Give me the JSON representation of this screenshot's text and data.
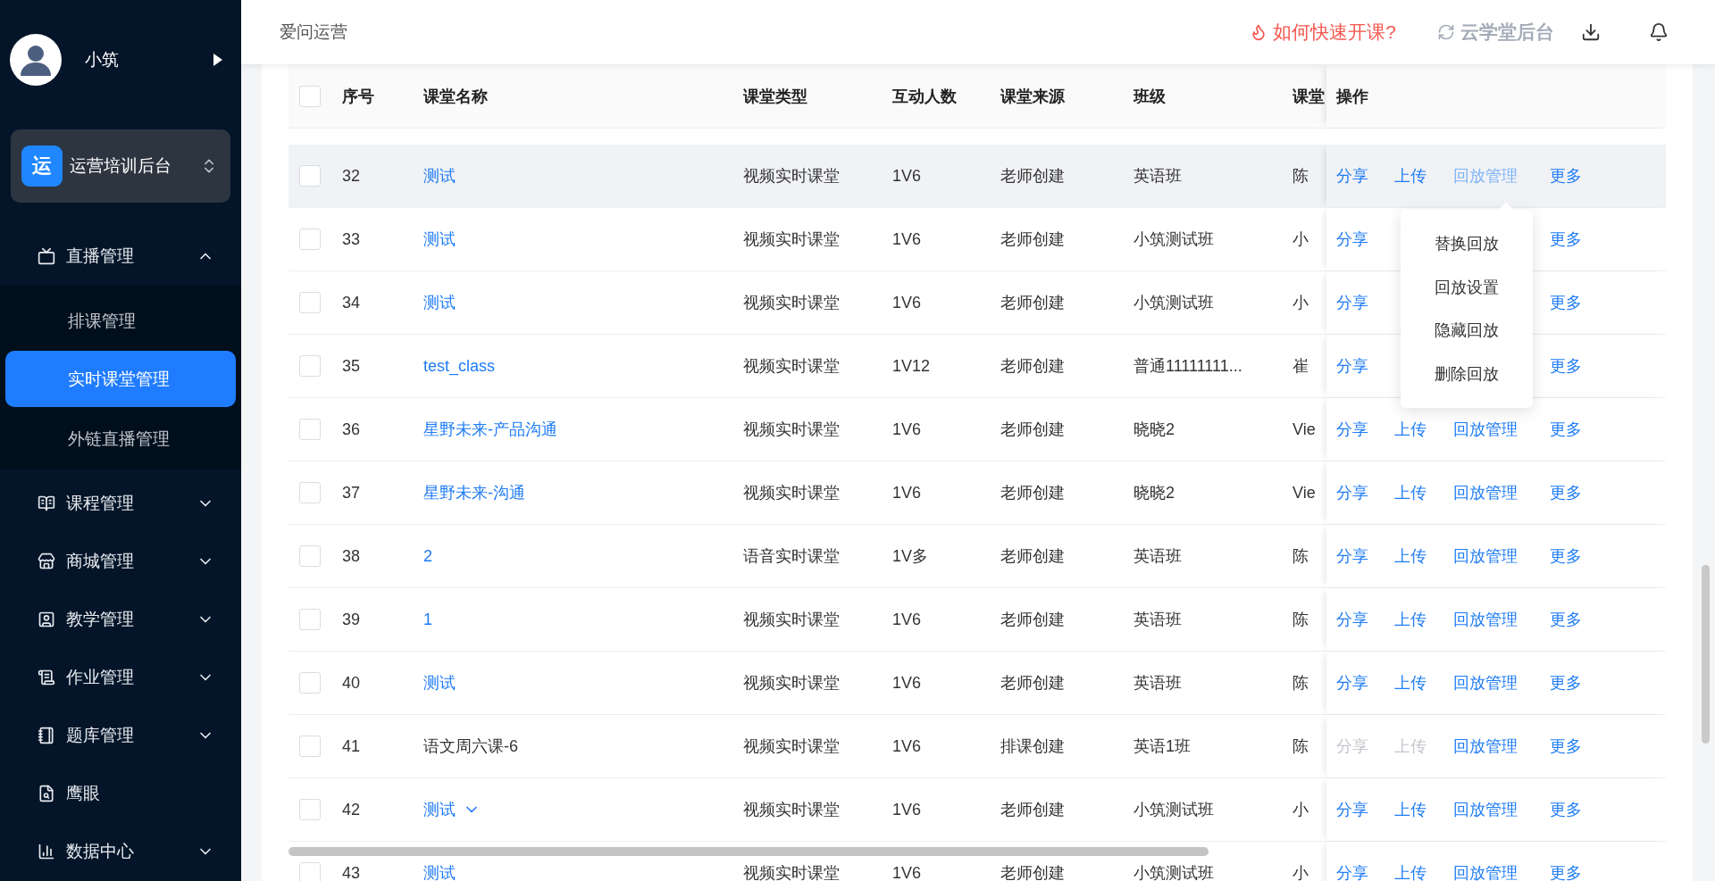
{
  "sidebar": {
    "user": {
      "name": "小筑"
    },
    "org": {
      "badge": "运",
      "name": "运营培训后台"
    },
    "menu": [
      {
        "label": "直播管理",
        "kind": "group",
        "expanded": true,
        "selected": false,
        "children": [
          {
            "label": "排课管理",
            "selected": false
          },
          {
            "label": "实时课堂管理",
            "selected": true
          },
          {
            "label": "外链直播管理",
            "selected": false
          }
        ]
      },
      {
        "label": "课程管理",
        "kind": "group",
        "expanded": false,
        "selected": false
      },
      {
        "label": "商城管理",
        "kind": "group",
        "expanded": false,
        "selected": false
      },
      {
        "label": "教学管理",
        "kind": "group",
        "expanded": false,
        "selected": false
      },
      {
        "label": "作业管理",
        "kind": "group",
        "expanded": false,
        "selected": false
      },
      {
        "label": "题库管理",
        "kind": "group",
        "expanded": false,
        "selected": false
      },
      {
        "label": "鹰眼",
        "kind": "page",
        "selected": false
      },
      {
        "label": "数据中心",
        "kind": "group",
        "expanded": false,
        "selected": false
      }
    ]
  },
  "header": {
    "title": "爱问运营",
    "help_link": "如何快速开课?",
    "switch_link": "云学堂后台"
  },
  "table": {
    "header_checked": false,
    "columns": [
      "序号",
      "课堂名称",
      "课堂类型",
      "互动人数",
      "课堂来源",
      "班级",
      "课堂",
      "操作"
    ],
    "rows": [
      {
        "checked": false,
        "hovered": true,
        "no": "32",
        "name": "测试",
        "name_link": true,
        "expandable": false,
        "type": "视频实时课堂",
        "members": "1V6",
        "source": "老师创建",
        "class": "英语班",
        "column_7": "陈",
        "actions": [
          {
            "kind": "share",
            "label": "分享",
            "disabled": false,
            "active": false
          },
          {
            "kind": "upload",
            "label": "上传",
            "disabled": false,
            "active": false
          },
          {
            "kind": "replay",
            "label": "回放管理",
            "disabled": false,
            "active": true
          },
          {
            "kind": "more",
            "label": "更多",
            "disabled": false,
            "active": false
          }
        ],
        "menu": {
          "items": [
            "替换回放",
            "回放设置",
            "隐藏回放",
            "删除回放"
          ]
        }
      },
      {
        "checked": false,
        "hovered": false,
        "no": "33",
        "name": "测试",
        "name_link": true,
        "expandable": false,
        "type": "视频实时课堂",
        "members": "1V6",
        "source": "老师创建",
        "class": "小筑测试班",
        "column_7": "小",
        "actions": [
          {
            "kind": "share",
            "label": "分享",
            "disabled": false,
            "active": false
          },
          {
            "kind": "more",
            "label": "更多",
            "disabled": false,
            "active": false
          }
        ]
      },
      {
        "checked": false,
        "hovered": false,
        "no": "34",
        "name": "测试",
        "name_link": true,
        "expandable": false,
        "type": "视频实时课堂",
        "members": "1V6",
        "source": "老师创建",
        "class": "小筑测试班",
        "column_7": "小",
        "actions": [
          {
            "kind": "share",
            "label": "分享",
            "disabled": false,
            "active": false
          },
          {
            "kind": "more",
            "label": "更多",
            "disabled": false,
            "active": false
          }
        ]
      },
      {
        "checked": false,
        "hovered": false,
        "no": "35",
        "name": "test_class",
        "name_link": true,
        "expandable": false,
        "type": "视频实时课堂",
        "members": "1V12",
        "source": "老师创建",
        "class": "普通11111111...",
        "column_7": "崔",
        "actions": [
          {
            "kind": "share",
            "label": "分享",
            "disabled": false,
            "active": false
          },
          {
            "kind": "more",
            "label": "更多",
            "disabled": false,
            "active": false
          }
        ]
      },
      {
        "checked": false,
        "hovered": false,
        "no": "36",
        "name": "星野未来-产品沟通",
        "name_link": true,
        "expandable": false,
        "type": "视频实时课堂",
        "members": "1V6",
        "source": "老师创建",
        "class": "晓晓2",
        "column_7": "Vie",
        "actions": [
          {
            "kind": "share",
            "label": "分享",
            "disabled": false,
            "active": false
          },
          {
            "kind": "upload",
            "label": "上传",
            "disabled": false,
            "active": false
          },
          {
            "kind": "replay",
            "label": "回放管理",
            "disabled": false,
            "active": false
          },
          {
            "kind": "more",
            "label": "更多",
            "disabled": false,
            "active": false
          }
        ]
      },
      {
        "checked": false,
        "hovered": false,
        "no": "37",
        "name": "星野未来-沟通",
        "name_link": true,
        "expandable": false,
        "type": "视频实时课堂",
        "members": "1V6",
        "source": "老师创建",
        "class": "晓晓2",
        "column_7": "Vie",
        "actions": [
          {
            "kind": "share",
            "label": "分享",
            "disabled": false,
            "active": false
          },
          {
            "kind": "upload",
            "label": "上传",
            "disabled": false,
            "active": false
          },
          {
            "kind": "replay",
            "label": "回放管理",
            "disabled": false,
            "active": false
          },
          {
            "kind": "more",
            "label": "更多",
            "disabled": false,
            "active": false
          }
        ]
      },
      {
        "checked": false,
        "hovered": false,
        "no": "38",
        "name": "2",
        "name_link": true,
        "expandable": false,
        "type": "语音实时课堂",
        "members": "1V多",
        "source": "老师创建",
        "class": "英语班",
        "column_7": "陈",
        "actions": [
          {
            "kind": "share",
            "label": "分享",
            "disabled": false,
            "active": false
          },
          {
            "kind": "upload",
            "label": "上传",
            "disabled": false,
            "active": false
          },
          {
            "kind": "replay",
            "label": "回放管理",
            "disabled": false,
            "active": false
          },
          {
            "kind": "more",
            "label": "更多",
            "disabled": false,
            "active": false
          }
        ]
      },
      {
        "checked": false,
        "hovered": false,
        "no": "39",
        "name": "1",
        "name_link": true,
        "expandable": false,
        "type": "视频实时课堂",
        "members": "1V6",
        "source": "老师创建",
        "class": "英语班",
        "column_7": "陈",
        "actions": [
          {
            "kind": "share",
            "label": "分享",
            "disabled": false,
            "active": false
          },
          {
            "kind": "upload",
            "label": "上传",
            "disabled": false,
            "active": false
          },
          {
            "kind": "replay",
            "label": "回放管理",
            "disabled": false,
            "active": false
          },
          {
            "kind": "more",
            "label": "更多",
            "disabled": false,
            "active": false
          }
        ]
      },
      {
        "checked": false,
        "hovered": false,
        "no": "40",
        "name": "测试",
        "name_link": true,
        "expandable": false,
        "type": "视频实时课堂",
        "members": "1V6",
        "source": "老师创建",
        "class": "英语班",
        "column_7": "陈",
        "actions": [
          {
            "kind": "share",
            "label": "分享",
            "disabled": false,
            "active": false
          },
          {
            "kind": "upload",
            "label": "上传",
            "disabled": false,
            "active": false
          },
          {
            "kind": "replay",
            "label": "回放管理",
            "disabled": false,
            "active": false
          },
          {
            "kind": "more",
            "label": "更多",
            "disabled": false,
            "active": false
          }
        ]
      },
      {
        "checked": false,
        "hovered": false,
        "no": "41",
        "name": "语文周六课-6",
        "name_link": false,
        "expandable": false,
        "type": "视频实时课堂",
        "members": "1V6",
        "source": "排课创建",
        "class": "英语1班",
        "column_7": "陈",
        "actions": [
          {
            "kind": "share",
            "label": "分享",
            "disabled": true,
            "active": false
          },
          {
            "kind": "upload",
            "label": "上传",
            "disabled": true,
            "active": false
          },
          {
            "kind": "replay",
            "label": "回放管理",
            "disabled": false,
            "active": false
          },
          {
            "kind": "more",
            "label": "更多",
            "disabled": false,
            "active": false
          }
        ]
      },
      {
        "checked": false,
        "hovered": false,
        "no": "42",
        "name": "测试",
        "name_link": true,
        "expandable": true,
        "type": "视频实时课堂",
        "members": "1V6",
        "source": "老师创建",
        "class": "小筑测试班",
        "column_7": "小",
        "actions": [
          {
            "kind": "share",
            "label": "分享",
            "disabled": false,
            "active": false
          },
          {
            "kind": "upload",
            "label": "上传",
            "disabled": false,
            "active": false
          },
          {
            "kind": "replay",
            "label": "回放管理",
            "disabled": false,
            "active": false
          },
          {
            "kind": "more",
            "label": "更多",
            "disabled": false,
            "active": false
          }
        ]
      },
      {
        "checked": false,
        "hovered": false,
        "no": "43",
        "name": "测试",
        "name_link": true,
        "expandable": false,
        "type": "视频实时课堂",
        "members": "1V6",
        "source": "老师创建",
        "class": "小筑测试班",
        "column_7": "小",
        "actions": [
          {
            "kind": "share",
            "label": "分享",
            "disabled": false,
            "active": false
          },
          {
            "kind": "upload",
            "label": "上传",
            "disabled": false,
            "active": false
          },
          {
            "kind": "replay",
            "label": "回放管理",
            "disabled": false,
            "active": false
          },
          {
            "kind": "more",
            "label": "更多",
            "disabled": false,
            "active": false
          }
        ]
      }
    ]
  }
}
